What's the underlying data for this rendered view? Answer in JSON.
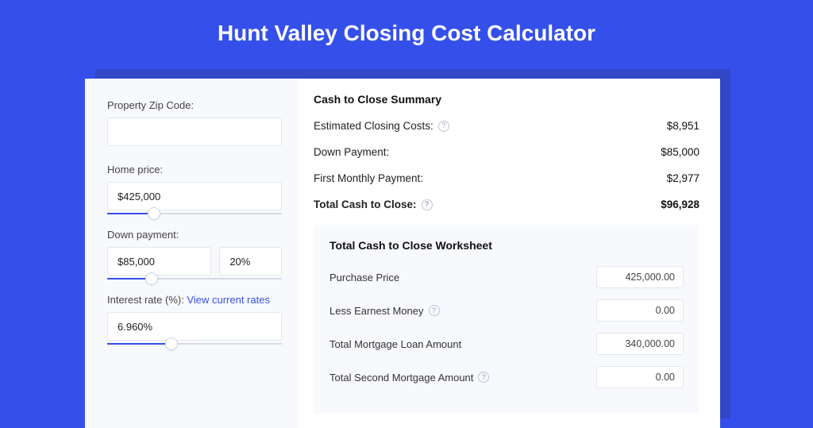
{
  "page": {
    "title": "Hunt Valley Closing Cost Calculator"
  },
  "form": {
    "zip": {
      "label": "Property Zip Code:",
      "value": ""
    },
    "home_price": {
      "label": "Home price:",
      "value": "$425,000",
      "slider_percent": 23
    },
    "down_payment": {
      "label": "Down payment:",
      "value": "$85,000",
      "percent_value": "20%",
      "slider_percent": 22
    },
    "interest_rate": {
      "label": "Interest rate (%): ",
      "link": "View current rates",
      "value": "6.960%",
      "slider_percent": 33
    }
  },
  "summary": {
    "title": "Cash to Close Summary",
    "rows": [
      {
        "label": "Estimated Closing Costs:",
        "help": true,
        "value": "$8,951",
        "bold": false
      },
      {
        "label": "Down Payment:",
        "help": false,
        "value": "$85,000",
        "bold": false
      },
      {
        "label": "First Monthly Payment:",
        "help": false,
        "value": "$2,977",
        "bold": false
      },
      {
        "label": "Total Cash to Close:",
        "help": true,
        "value": "$96,928",
        "bold": true
      }
    ]
  },
  "worksheet": {
    "title": "Total Cash to Close Worksheet",
    "rows": [
      {
        "label": "Purchase Price",
        "help": false,
        "value": "425,000.00"
      },
      {
        "label": "Less Earnest Money",
        "help": true,
        "value": "0.00"
      },
      {
        "label": "Total Mortgage Loan Amount",
        "help": false,
        "value": "340,000.00"
      },
      {
        "label": "Total Second Mortgage Amount",
        "help": true,
        "value": "0.00"
      }
    ]
  }
}
